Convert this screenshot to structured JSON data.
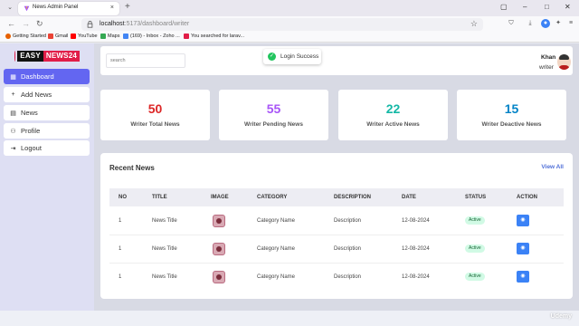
{
  "browser": {
    "tab_title": "News Admin Panel",
    "url_host": "localhost",
    "url_path": ":5173/dashboard/writer",
    "bookmarks": [
      {
        "label": "Getting Started",
        "color": "#e66000"
      },
      {
        "label": "Gmail",
        "color": "#ea4335"
      },
      {
        "label": "YouTube",
        "color": "#ff0000"
      },
      {
        "label": "Maps",
        "color": "#34a853"
      },
      {
        "label": "(169) - Inbox - Zoho ...",
        "color": "#4285f4"
      },
      {
        "label": "You searched for larav...",
        "color": "#e11d48"
      }
    ]
  },
  "app": {
    "logo": {
      "easy": "EASY",
      "news": "NEWS24"
    },
    "sidebar": {
      "items": [
        {
          "label": "Dashboard",
          "icon": "dashboard-icon",
          "active": true
        },
        {
          "label": "Add News",
          "icon": "plus-icon",
          "active": false
        },
        {
          "label": "News",
          "icon": "news-icon",
          "active": false
        },
        {
          "label": "Profile",
          "icon": "user-icon",
          "active": false
        },
        {
          "label": "Logout",
          "icon": "logout-icon",
          "active": false
        }
      ]
    },
    "header": {
      "search_placeholder": "search",
      "toast": "Login Success",
      "user_name": "Khan",
      "user_role": "writer"
    },
    "stats": [
      {
        "value": "50",
        "label": "Writer Total News",
        "color": "#dc2626"
      },
      {
        "value": "55",
        "label": "Writer Pending News",
        "color": "#a855f7"
      },
      {
        "value": "22",
        "label": "Writer Active News",
        "color": "#14b8a6"
      },
      {
        "value": "15",
        "label": "Writer Deactive News",
        "color": "#0284c7"
      }
    ],
    "recent": {
      "title": "Recent News",
      "view_all": "View All",
      "columns": [
        "NO",
        "TITLE",
        "IMAGE",
        "CATEGORY",
        "DESCRIPTION",
        "DATE",
        "STATUS",
        "ACTION"
      ],
      "rows": [
        {
          "no": "1",
          "title": "News Title",
          "category": "Category Name",
          "description": "Description",
          "date": "12-08-2024",
          "status": "Active"
        },
        {
          "no": "1",
          "title": "News Title",
          "category": "Category Name",
          "description": "Description",
          "date": "12-08-2024",
          "status": "Active"
        },
        {
          "no": "1",
          "title": "News Title",
          "category": "Category Name",
          "description": "Description",
          "date": "12-08-2024",
          "status": "Active"
        }
      ]
    }
  },
  "watermark": "Udemy"
}
